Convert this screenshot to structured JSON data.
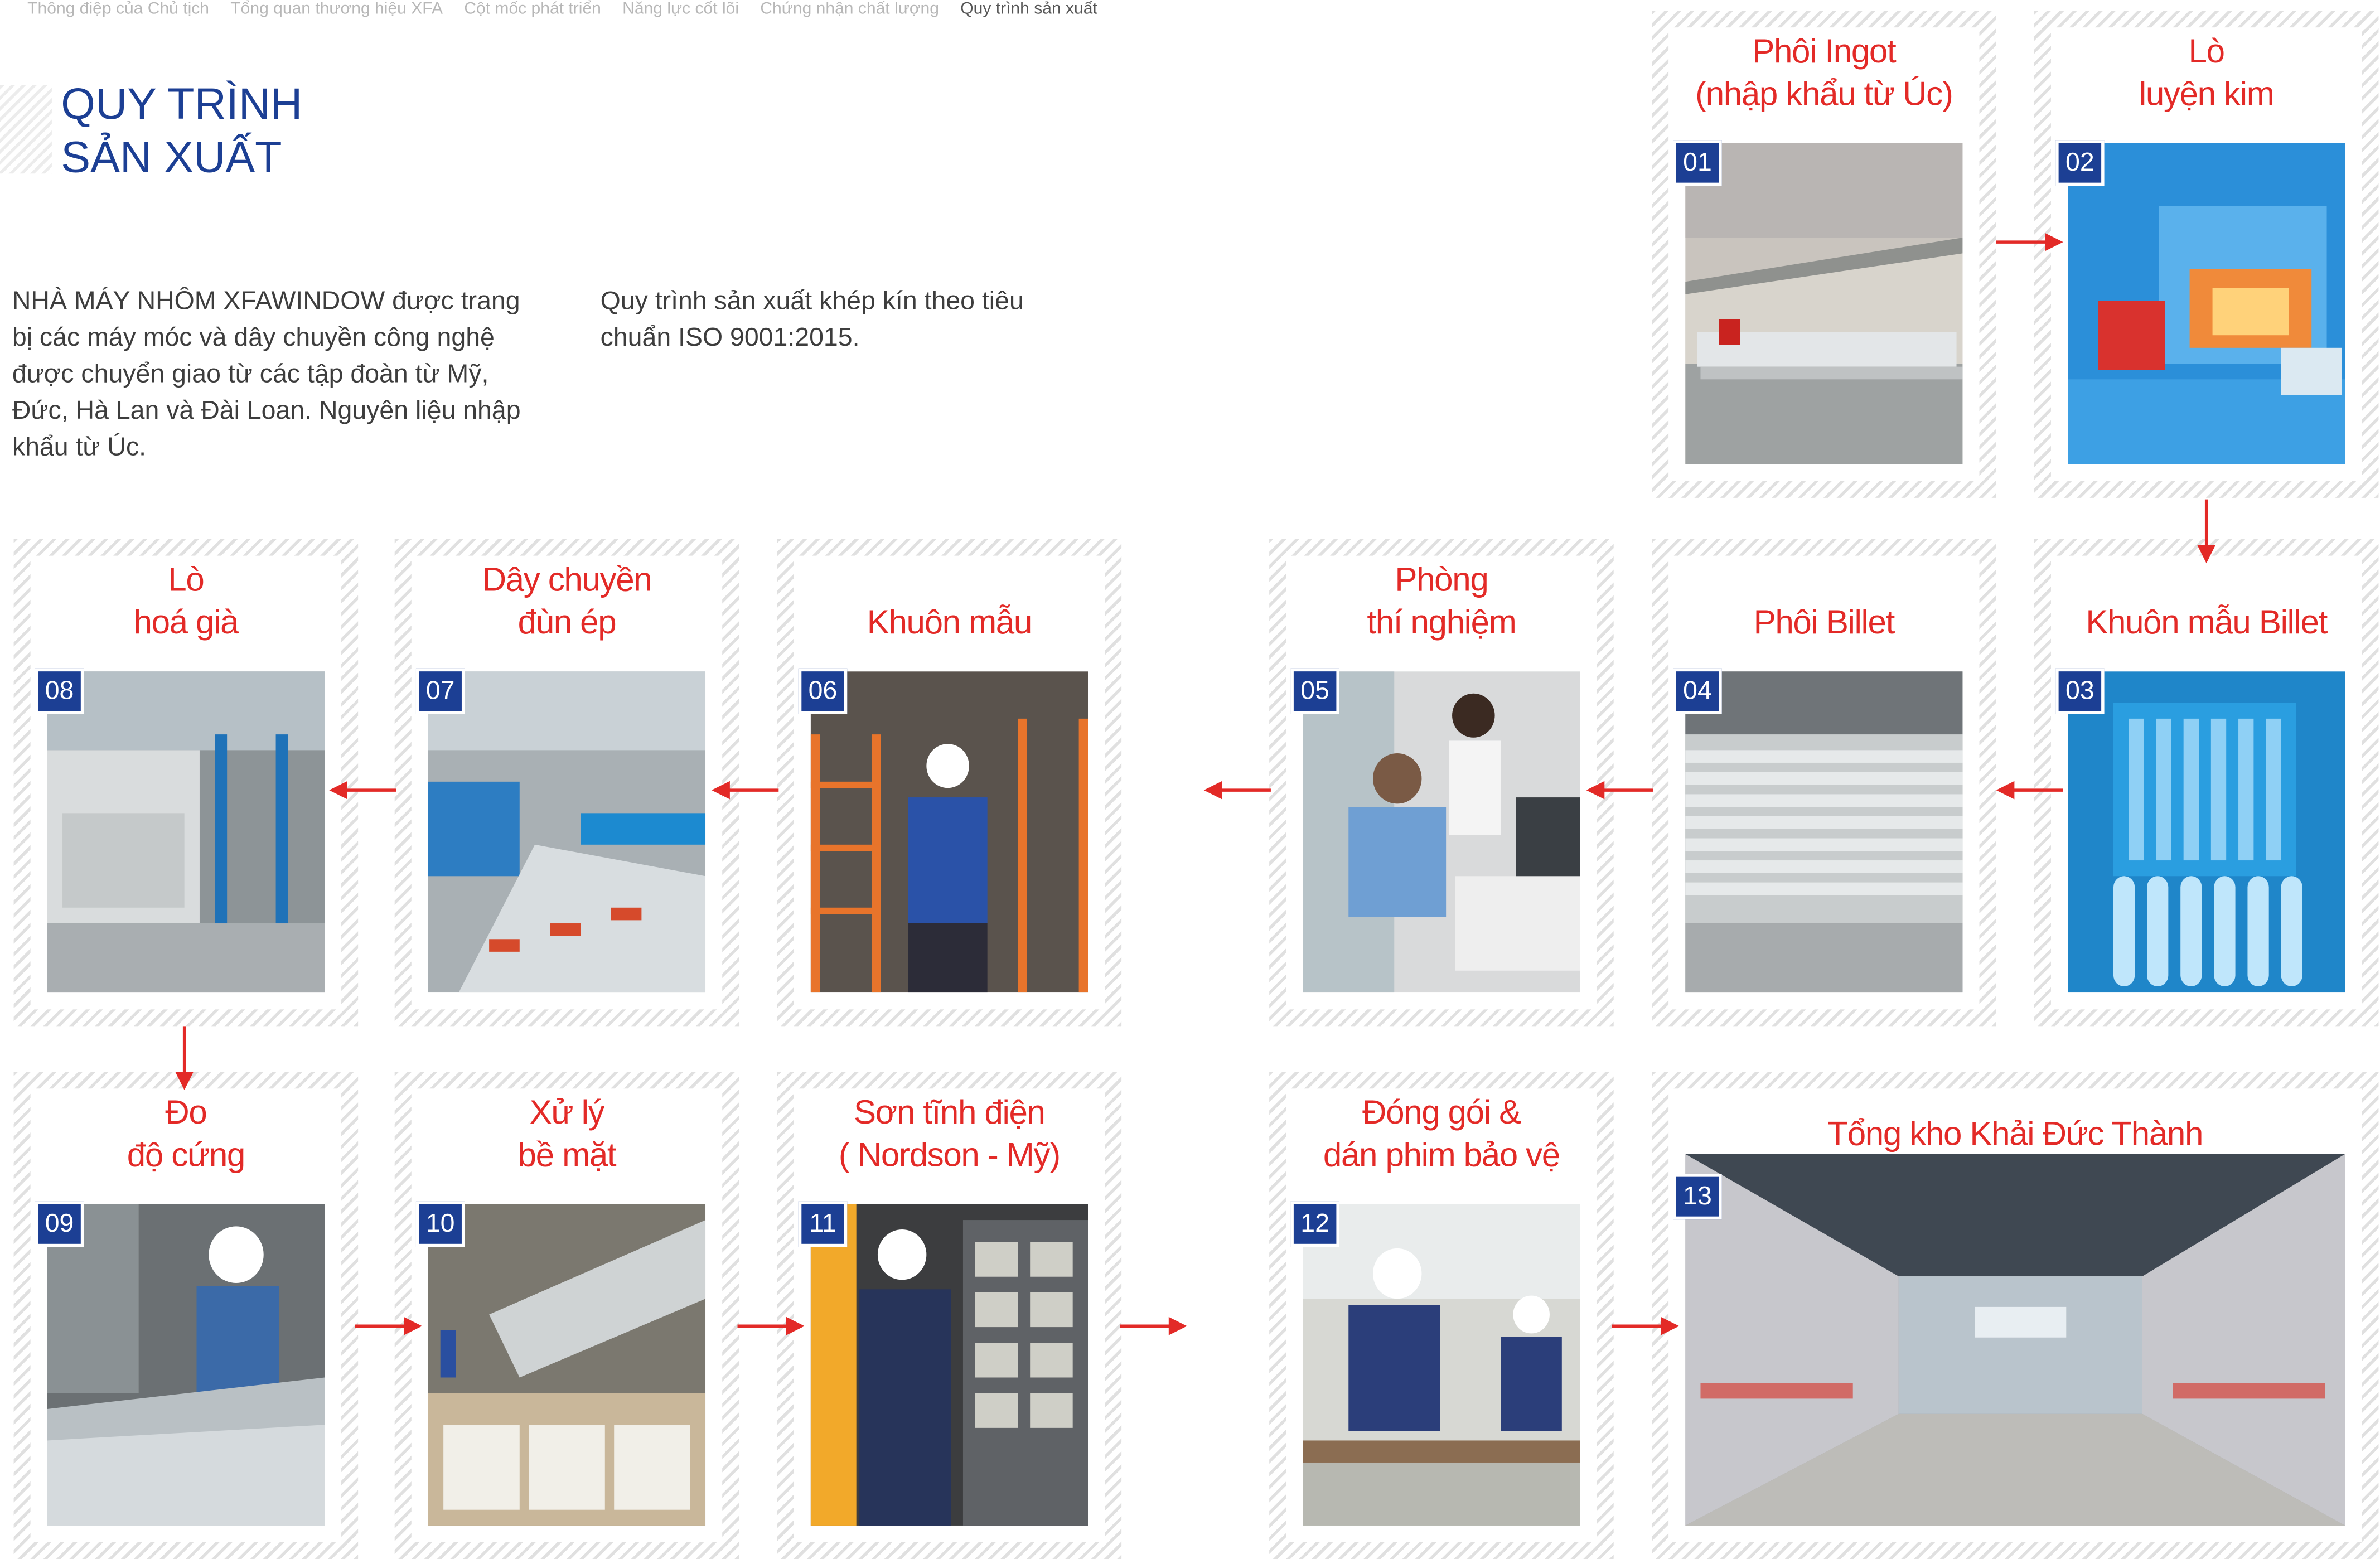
{
  "breadcrumb": [
    "Thông điệp của Chủ tịch",
    "Tổng quan thương hiệu XFA",
    "Cột mốc phát triển",
    "Năng lực cốt lõi",
    "Chứng nhận chất lượng",
    "Quy trình sản xuất"
  ],
  "page_title": {
    "line1": "QUY TRÌNH",
    "line2": "SẢN XUẤT"
  },
  "intro": {
    "left": "NHÀ MÁY NHÔM XFAWINDOW được trang bị các máy móc và dây chuyền công nghệ được chuyển giao từ các tập đoàn từ Mỹ, Đức, Hà Lan và Đài Loan. Nguyên liệu nhập khẩu từ Úc.",
    "right": "Quy trình sản xuất khép kín theo tiêu chuẩn ISO 9001:2015."
  },
  "steps": [
    {
      "num": "01",
      "line1": "Phôi Ingot",
      "line2": "(nhập khẩu từ Úc)"
    },
    {
      "num": "02",
      "line1": "Lò",
      "line2": "luyện kim"
    },
    {
      "num": "03",
      "line1": "",
      "line2": "Khuôn mẫu Billet"
    },
    {
      "num": "04",
      "line1": "",
      "line2": "Phôi Billet"
    },
    {
      "num": "05",
      "line1": "Phòng",
      "line2": "thí nghiệm"
    },
    {
      "num": "06",
      "line1": "",
      "line2": "Khuôn mẫu"
    },
    {
      "num": "07",
      "line1": "Dây chuyền",
      "line2": "đùn ép"
    },
    {
      "num": "08",
      "line1": "Lò",
      "line2": "hoá già"
    },
    {
      "num": "09",
      "line1": "Đo",
      "line2": "độ cứng"
    },
    {
      "num": "10",
      "line1": "Xử lý",
      "line2": "bề mặt"
    },
    {
      "num": "11",
      "line1": "Sơn tĩnh điện",
      "line2": "( Nordson - Mỹ)"
    },
    {
      "num": "12",
      "line1": "Đóng gói &",
      "line2": "dán phim bảo vệ"
    },
    {
      "num": "13",
      "line1": "Tổng kho Khải Đức Thành",
      "line2": ""
    }
  ],
  "colors": {
    "title_blue": "#1c3f94",
    "step_red": "#e32a27",
    "badge_blue": "#1c3f94"
  },
  "icons": {
    "flow_arrow": "arrow-icon"
  }
}
